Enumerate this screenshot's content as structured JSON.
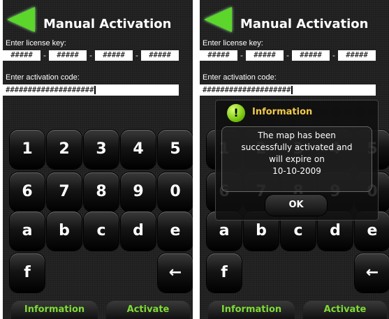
{
  "title": "Manual Activation",
  "license_label": "Enter license key:",
  "license_fields": [
    "#####",
    "#####",
    "#####",
    "#####"
  ],
  "activation_label": "Enter activation code:",
  "activation_value": "####################",
  "keypad": [
    "1",
    "2",
    "3",
    "4",
    "5",
    "6",
    "7",
    "8",
    "9",
    "0",
    "a",
    "b",
    "c",
    "d",
    "e",
    "f"
  ],
  "backspace_symbol": "←",
  "buttons": {
    "information": "Information",
    "activate": "Activate"
  },
  "dialog": {
    "title": "Information",
    "icon_glyph": "!",
    "lines": [
      "The map has been",
      "successfully activated and",
      "will expire on",
      "10-10-2009"
    ],
    "ok": "OK"
  },
  "colors": {
    "accent_green": "#7edc35",
    "dialog_title": "#f2c94a",
    "back_arrow": "#5cd62a"
  }
}
